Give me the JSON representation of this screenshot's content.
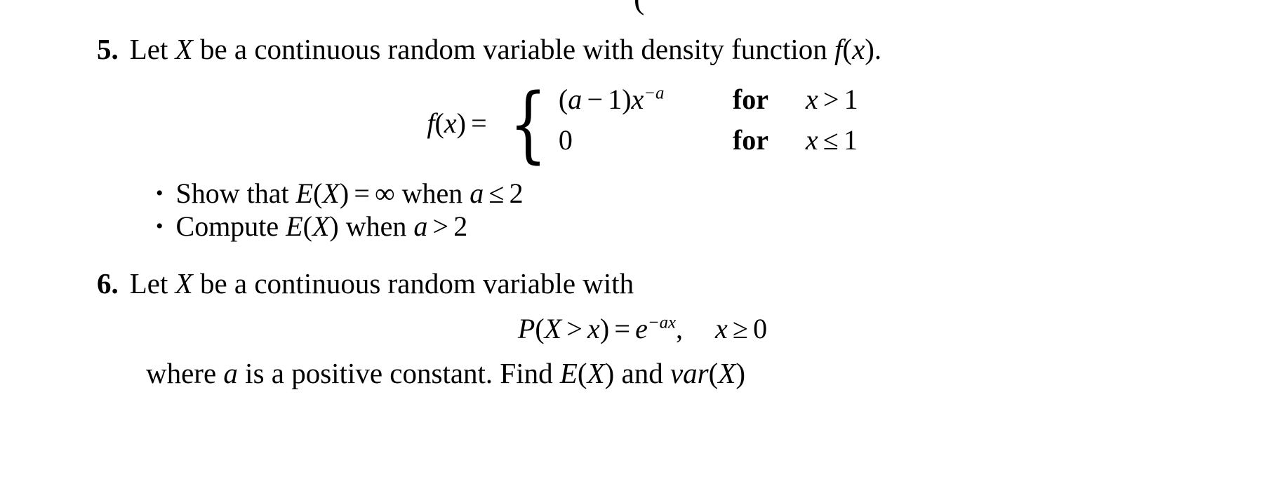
{
  "document": {
    "type": "math-problem-set",
    "background_color": "#ffffff",
    "text_color": "#000000",
    "top_clipped_glyph": "("
  },
  "problems": [
    {
      "number": "5.",
      "statement": {
        "before_var": "Let",
        "variable": "X",
        "middle": "be a continuous random variable with density function",
        "function_name": "f",
        "function_arg": "x",
        "trailing": "."
      },
      "equation": {
        "lhs_fn": "f",
        "lhs_arg": "x",
        "equals": "=",
        "cases": [
          {
            "value_open_paren": "(",
            "value_var": "a",
            "value_minus": "−",
            "value_one": "1",
            "value_close_paren": ")",
            "value_base": "x",
            "value_exponent_minus": "−",
            "value_exponent_var": "a",
            "for_label": "for",
            "cond_var": "x",
            "cond_rel": ">",
            "cond_num": "1"
          },
          {
            "value_zero": "0",
            "for_label": "for",
            "cond_var": "x",
            "cond_rel": "≤",
            "cond_num": "1"
          }
        ]
      },
      "bullets": [
        {
          "marker": "•",
          "lead": "Show that",
          "expr_fn": "E",
          "expr_arg": "X",
          "equals": "=",
          "infinity": "∞",
          "when": "when",
          "cond_var": "a",
          "cond_rel": "≤",
          "cond_num": "2"
        },
        {
          "marker": "•",
          "lead": "Compute",
          "expr_fn": "E",
          "expr_arg": "X",
          "when": "when",
          "cond_var": "a",
          "cond_rel": ">",
          "cond_num": "2"
        }
      ]
    },
    {
      "number": "6.",
      "statement": {
        "before_var": "Let",
        "variable": "X",
        "middle": "be a continuous random variable with"
      },
      "equation": {
        "prob_fn": "P",
        "open_paren": "(",
        "var_big": "X",
        "rel": ">",
        "var_small": "x",
        "close_paren": ")",
        "equals": "=",
        "exp_base": "e",
        "exp_minus": "−",
        "exp_a": "a",
        "exp_x": "x",
        "comma": ",",
        "cond_var": "x",
        "cond_rel": "≥",
        "cond_num": "0"
      },
      "closing": {
        "lead": "where",
        "const_var": "a",
        "middle": "is a positive constant. Find",
        "e_fn": "E",
        "e_arg": "X",
        "and": "and",
        "var_fn": "var",
        "var_arg": "X"
      }
    }
  ]
}
